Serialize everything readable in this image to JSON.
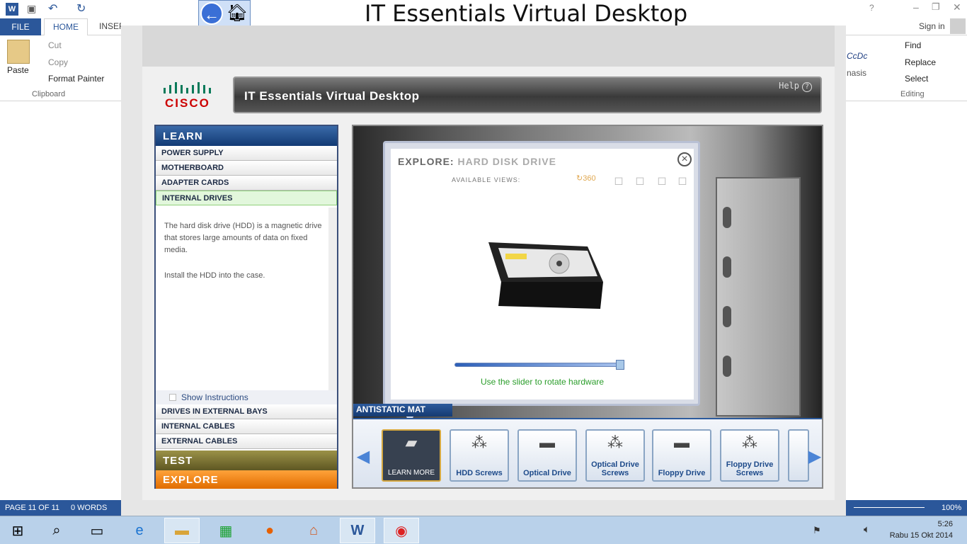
{
  "word": {
    "tabs": {
      "file": "FILE",
      "home": "HOME",
      "insert": "INSER"
    },
    "clipboard": {
      "paste": "Paste",
      "cut": "Cut",
      "copy": "Copy",
      "format_painter": "Format Painter",
      "group_label": "Clipboard"
    },
    "editing": {
      "find": "Find",
      "replace": "Replace",
      "select": "Select",
      "group_label": "Editing"
    },
    "styles_fragment": {
      "style_name": "CcDc",
      "emphasis": "nasis"
    },
    "sign_in": "Sign in",
    "status": {
      "page": "PAGE 11 OF 11",
      "words": "0 WORDS",
      "zoom": "100%"
    }
  },
  "app": {
    "title": "IT Essentials Virtual Desktop",
    "banner_title": "IT Essentials Virtual Desktop",
    "help_label": "Help",
    "logo_text": "CISCO",
    "learn_heading": "LEARN",
    "menu_top": [
      {
        "label": "POWER SUPPLY",
        "active": false
      },
      {
        "label": "MOTHERBOARD",
        "active": false
      },
      {
        "label": "ADAPTER CARDS",
        "active": false
      },
      {
        "label": "INTERNAL DRIVES",
        "active": true
      }
    ],
    "description": [
      "The hard disk drive (HDD) is a magnetic drive that stores large amounts of data on fixed media.",
      "Install the HDD into the case."
    ],
    "show_instructions": "Show Instructions",
    "menu_bottom": [
      {
        "label": "DRIVES IN EXTERNAL BAYS"
      },
      {
        "label": "INTERNAL CABLES"
      },
      {
        "label": "EXTERNAL CABLES"
      }
    ],
    "test_heading": "TEST",
    "explore_heading": "EXPLORE",
    "explore_dialog": {
      "title_prefix": "EXPLORE:",
      "title_item": "HARD DISK DRIVE",
      "views_label": "AVAILABLE VIEWS:",
      "slider_caption": "Use the slider to rotate hardware"
    },
    "antistatic_label": "ANTISTATIC MAT",
    "tray_items": [
      {
        "label": "LEARN MORE",
        "icon": "hdd-icon",
        "selected": true
      },
      {
        "label": "HDD Screws",
        "icon": "screws-icon",
        "selected": false
      },
      {
        "label": "Optical Drive",
        "icon": "optical-drive-icon",
        "selected": false
      },
      {
        "label": "Optical Drive Screws",
        "icon": "screws-icon",
        "selected": false
      },
      {
        "label": "Floppy Drive",
        "icon": "floppy-drive-icon",
        "selected": false
      },
      {
        "label": "Floppy Drive Screws",
        "icon": "screws-icon",
        "selected": false
      }
    ]
  },
  "taskbar": {
    "icons": [
      "start-icon",
      "search-icon",
      "task-view-icon",
      "internet-explorer-icon",
      "file-explorer-icon",
      "store-icon",
      "firefox-icon",
      "home-icon",
      "word-icon",
      "cisco-app-icon"
    ],
    "time": "5:26",
    "date": "Rabu 15 Okt 2014"
  }
}
